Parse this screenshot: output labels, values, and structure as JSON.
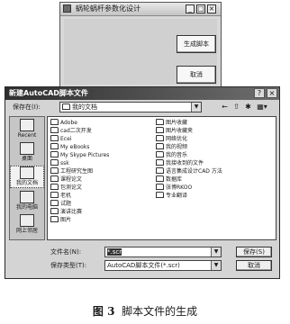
{
  "generator_window": {
    "title": "蜗轮蜗杆参数化设计",
    "minimize": "_",
    "maximize": "□",
    "close": "×",
    "generate_button": "生成脚本",
    "cancel_button": "取消"
  },
  "save_dialog": {
    "title": "新建AutoCAD脚本文件",
    "help": "?",
    "close": "×",
    "save_in_label": "保存在(I):",
    "save_in_value": "我的文档",
    "places": [
      {
        "label": "Recent",
        "icon": "recent-icon"
      },
      {
        "label": "桌面",
        "icon": "desktop-icon"
      },
      {
        "label": "我的文档",
        "icon": "my-documents-icon"
      },
      {
        "label": "我的电脑",
        "icon": "my-computer-icon"
      },
      {
        "label": "网上邻居",
        "icon": "network-icon"
      }
    ],
    "files_col1": [
      "Adobe",
      "cad二次开发",
      "Ecei",
      "My eBooks",
      "My Skype Pictures",
      "ssk",
      "工程研究生图",
      "课程论文",
      "包测论文",
      "老机",
      "试题",
      "演讲比赛",
      "图片"
    ],
    "files_col2": [
      "图片收藏",
      "图片收藏夹",
      "网络优化",
      "我的视频",
      "我的音乐",
      "我接收到的文件",
      "语言集成设计CAD 方法",
      "数据库",
      "张博RKOO",
      "专业翻译"
    ],
    "file_name_label": "文件名(N):",
    "file_name_value": "*.scr",
    "file_type_label": "保存类型(T):",
    "file_type_value": "AutoCAD脚本文件(*.scr)",
    "save_button": "保存(S)",
    "cancel_button": "取消"
  },
  "caption": {
    "figure": "图 3",
    "text": "脚本文件的生成"
  }
}
